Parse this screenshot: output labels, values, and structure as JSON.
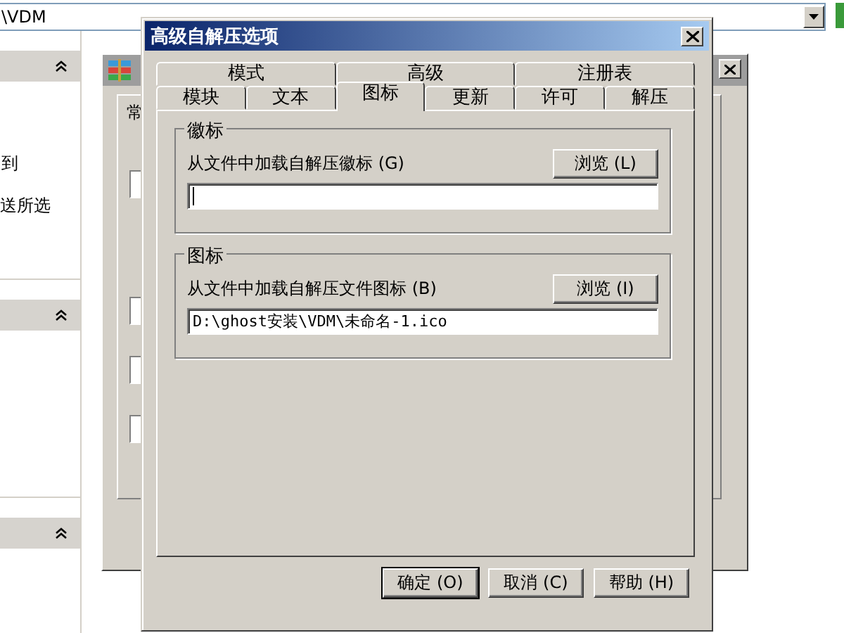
{
  "address_bar": {
    "value": "\\VDM"
  },
  "task_panel": {
    "texts": [
      "到",
      "送所选"
    ]
  },
  "back_window": {
    "tab": "常"
  },
  "dialog": {
    "title": "高级自解压选项",
    "tab_rows": [
      [
        {
          "label": "模式",
          "selected": false
        },
        {
          "label": "高级",
          "selected": false
        },
        {
          "label": "注册表",
          "selected": false
        }
      ],
      [
        {
          "label": "模块",
          "selected": false
        },
        {
          "label": "文本",
          "selected": false
        },
        {
          "label": "图标",
          "selected": true
        },
        {
          "label": "更新",
          "selected": false
        },
        {
          "label": "许可",
          "selected": false
        },
        {
          "label": "解压",
          "selected": false
        }
      ]
    ],
    "groups": [
      {
        "title": "徽标",
        "label": "从文件中加载自解压徽标 (G)",
        "button": "浏览 (L)",
        "focused": true
      },
      {
        "title": "图标",
        "label": "从文件中加载自解压文件图标 (B)",
        "button": "浏览 (I)",
        "value": "D:\\ghost安装\\VDM\\未命名-1.ico",
        "focused": false
      }
    ],
    "buttons": [
      {
        "label": "确定 (O)",
        "default": true
      },
      {
        "label": "取消 (C)",
        "default": false
      },
      {
        "label": "帮助 (H)",
        "default": false
      }
    ]
  }
}
